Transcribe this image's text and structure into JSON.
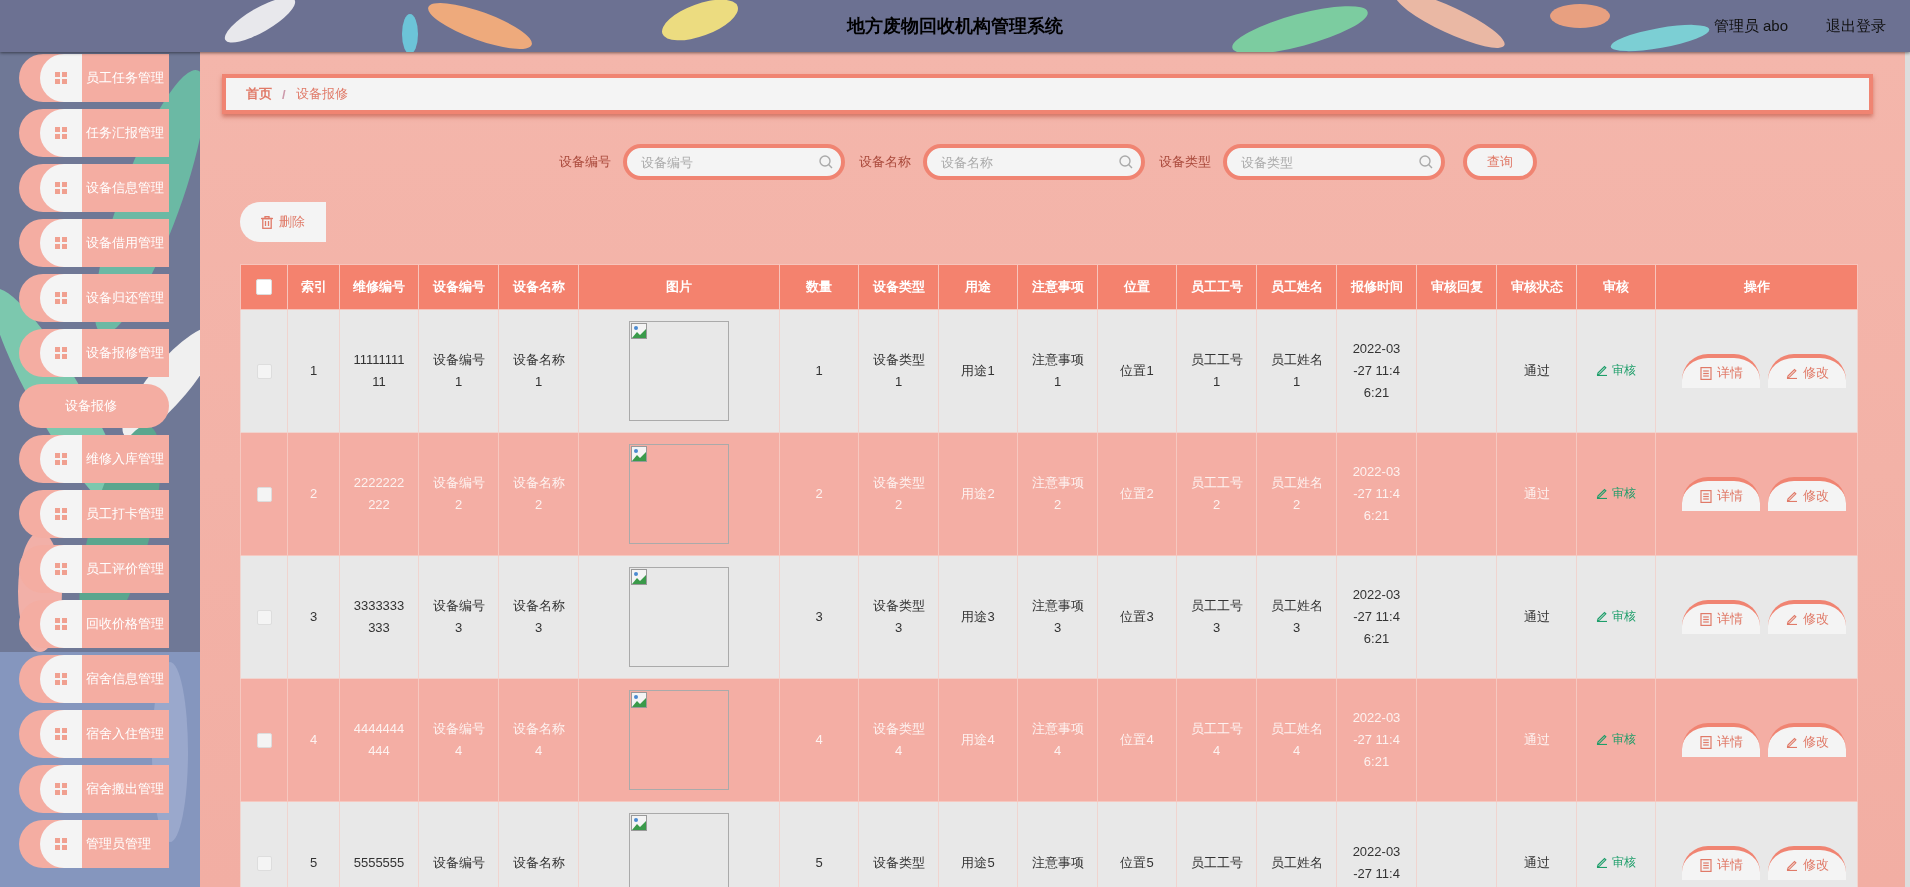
{
  "header": {
    "title": "地方废物回收机构管理系统",
    "user": "管理员 abo",
    "logout": "退出登录"
  },
  "sidebar": {
    "items": [
      {
        "label": "员工任务管理",
        "selected": false
      },
      {
        "label": "任务汇报管理",
        "selected": false
      },
      {
        "label": "设备信息管理",
        "selected": false
      },
      {
        "label": "设备借用管理",
        "selected": false
      },
      {
        "label": "设备归还管理",
        "selected": false
      },
      {
        "label": "设备报修管理",
        "selected": false,
        "children": [
          {
            "label": "设备报修",
            "selected": true
          }
        ]
      },
      {
        "label": "维修入库管理",
        "selected": false
      },
      {
        "label": "员工打卡管理",
        "selected": false
      },
      {
        "label": "员工评价管理",
        "selected": false
      },
      {
        "label": "回收价格管理",
        "selected": false
      },
      {
        "label": "宿舍信息管理",
        "selected": false
      },
      {
        "label": "宿舍入住管理",
        "selected": false
      },
      {
        "label": "宿舍搬出管理",
        "selected": false
      },
      {
        "label": "管理员管理",
        "selected": false
      }
    ]
  },
  "breadcrumb": {
    "items": [
      "首页",
      "设备报修"
    ],
    "separator": "/"
  },
  "search": {
    "fields": [
      {
        "label": "设备编号",
        "placeholder": "设备编号"
      },
      {
        "label": "设备名称",
        "placeholder": "设备名称"
      },
      {
        "label": "设备类型",
        "placeholder": "设备类型"
      }
    ],
    "button": "查询"
  },
  "delete_button": "删除",
  "table": {
    "select_all_checked": false,
    "columns": [
      "索引",
      "维修编号",
      "设备编号",
      "设备名称",
      "图片",
      "数量",
      "设备类型",
      "用途",
      "注意事项",
      "位置",
      "员工工号",
      "员工姓名",
      "报修时间",
      "审核回复",
      "审核状态",
      "审核",
      "操作"
    ],
    "rows": [
      {
        "checked": false,
        "index": "1",
        "repair_no": "1111111111",
        "device_no": "设备编号1",
        "device_name": "设备名称1",
        "quantity": "1",
        "device_type": "设备类型1",
        "purpose": "用途1",
        "notes": "注意事项1",
        "location": "位置1",
        "staff_no": "员工工号1",
        "staff_name": "员工姓名1",
        "report_time": "2022-03-27 11:46:21",
        "status": "通过",
        "review": "审核",
        "actions": [
          {
            "kind": "details",
            "label": "详情"
          },
          {
            "kind": "edit",
            "label": "修改"
          }
        ]
      },
      {
        "checked": false,
        "index": "2",
        "repair_no": "2222222222",
        "device_no": "设备编号2",
        "device_name": "设备名称2",
        "quantity": "2",
        "device_type": "设备类型2",
        "purpose": "用途2",
        "notes": "注意事项2",
        "location": "位置2",
        "staff_no": "员工工号2",
        "staff_name": "员工姓名2",
        "report_time": "2022-03-27 11:46:21",
        "status": "通过",
        "review": "审核",
        "actions": [
          {
            "kind": "details",
            "label": "详情"
          },
          {
            "kind": "edit",
            "label": "修改"
          }
        ]
      },
      {
        "checked": false,
        "index": "3",
        "repair_no": "3333333333",
        "device_no": "设备编号3",
        "device_name": "设备名称3",
        "quantity": "3",
        "device_type": "设备类型3",
        "purpose": "用途3",
        "notes": "注意事项3",
        "location": "位置3",
        "staff_no": "员工工号3",
        "staff_name": "员工姓名3",
        "report_time": "2022-03-27 11:46:21",
        "status": "通过",
        "review": "审核",
        "actions": [
          {
            "kind": "details",
            "label": "详情"
          },
          {
            "kind": "edit",
            "label": "修改"
          }
        ]
      },
      {
        "checked": false,
        "index": "4",
        "repair_no": "4444444444",
        "device_no": "设备编号4",
        "device_name": "设备名称4",
        "quantity": "4",
        "device_type": "设备类型4",
        "purpose": "用途4",
        "notes": "注意事项4",
        "location": "位置4",
        "staff_no": "员工工号4",
        "staff_name": "员工姓名4",
        "report_time": "2022-03-27 11:46:21",
        "status": "通过",
        "review": "审核",
        "actions": [
          {
            "kind": "details",
            "label": "详情"
          },
          {
            "kind": "edit",
            "label": "修改"
          }
        ]
      },
      {
        "checked": false,
        "index": "5",
        "repair_no": "5555555",
        "device_no": "设备编号",
        "device_name": "设备名称",
        "quantity": "5",
        "device_type": "设备类型",
        "purpose": "用途5",
        "notes": "注意事项",
        "location": "位置5",
        "staff_no": "员工工号",
        "staff_name": "员工姓名",
        "report_time": "2022-03-27 11:4",
        "status": "通过",
        "review": "审核",
        "actions": [
          {
            "kind": "details",
            "label": "详情"
          },
          {
            "kind": "edit",
            "label": "修改"
          }
        ]
      }
    ]
  }
}
